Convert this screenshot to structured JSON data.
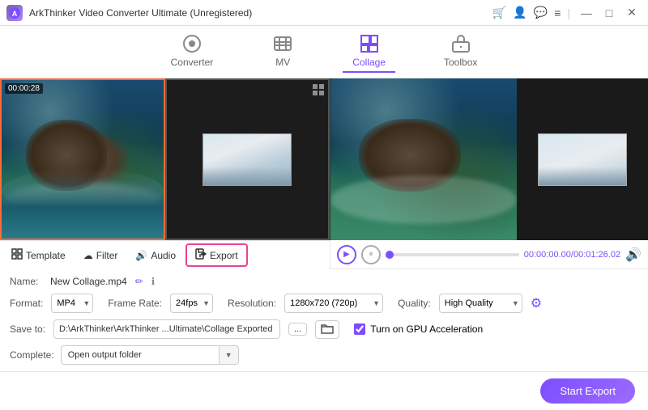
{
  "titleBar": {
    "appName": "ArkThinker Video Converter Ultimate (Unregistered)",
    "logo": "A"
  },
  "topNav": {
    "items": [
      {
        "id": "converter",
        "label": "Converter",
        "icon": "⏺",
        "active": false
      },
      {
        "id": "mv",
        "label": "MV",
        "icon": "🎬",
        "active": false
      },
      {
        "id": "collage",
        "label": "Collage",
        "icon": "⊞",
        "active": true
      },
      {
        "id": "toolbox",
        "label": "Toolbox",
        "icon": "🧰",
        "active": false
      }
    ]
  },
  "collageEditor": {
    "leftPanel": {
      "timestamp": "00:00:28"
    }
  },
  "tabs": [
    {
      "id": "template",
      "label": "Template",
      "icon": "⊞",
      "active": false
    },
    {
      "id": "filter",
      "label": "Filter",
      "icon": "☁",
      "active": false
    },
    {
      "id": "audio",
      "label": "Audio",
      "icon": "🔊",
      "active": false
    },
    {
      "id": "export",
      "label": "Export",
      "icon": "📤",
      "active": true
    }
  ],
  "playback": {
    "currentTime": "00:00:00.00",
    "totalTime": "00:01:26.02"
  },
  "settings": {
    "nameLabel": "Name:",
    "nameValue": "New Collage.mp4",
    "formatLabel": "Format:",
    "formatValue": "MP4",
    "frameRateLabel": "Frame Rate:",
    "frameRateValue": "24fps",
    "resolutionLabel": "Resolution:",
    "resolutionValue": "1280x720 (720p)",
    "qualityLabel": "Quality:",
    "qualityValue": "High Quality",
    "saveToLabel": "Save to:",
    "savePath": "D:\\ArkThinker\\ArkThinker ...Ultimate\\Collage Exported",
    "browseLabel": "...",
    "gpuLabel": "Turn on GPU Acceleration",
    "completeLabel": "Complete:",
    "completeValue": "Open output folder"
  },
  "bottomBar": {
    "startExportLabel": "Start Export"
  },
  "icons": {
    "play": "▶",
    "pause": "⏸",
    "volume": "🔊",
    "edit": "✏",
    "info": "ℹ",
    "gear": "⚙",
    "folder": "📁",
    "browse": "...",
    "minimize": "—",
    "maximize": "□",
    "close": "✕",
    "cart": "🛒",
    "question": "?",
    "chat": "💬",
    "menu": "≡",
    "gpu": "🖥"
  }
}
